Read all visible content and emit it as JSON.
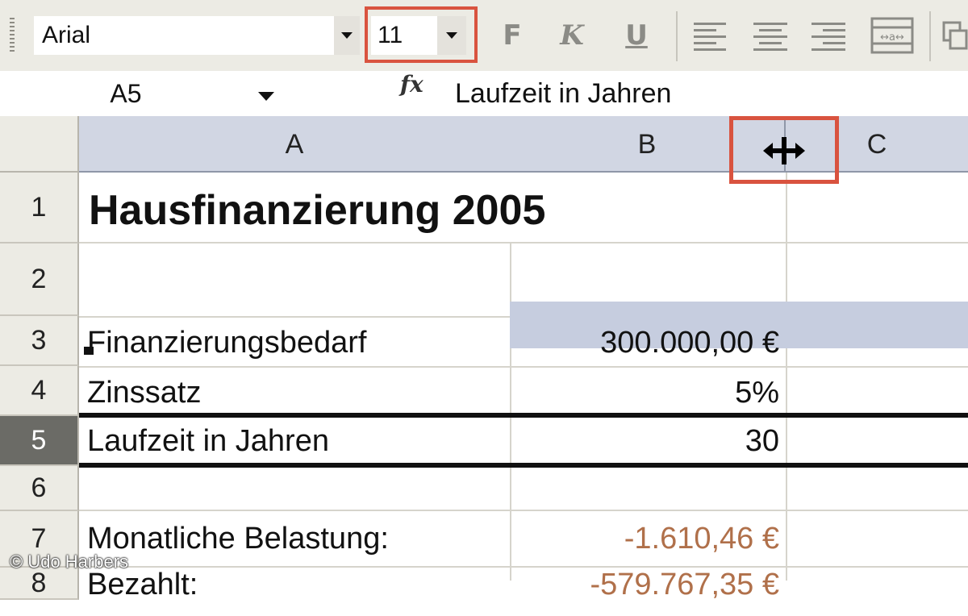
{
  "toolbar": {
    "font_name": "Arial",
    "font_size": "11",
    "bold_label": "F",
    "italic_label": "K",
    "underline_label": "U"
  },
  "formula_bar": {
    "name_box": "A5",
    "fx_label": "fx",
    "content": "Laufzeit in Jahren"
  },
  "columns": [
    "A",
    "B",
    "C"
  ],
  "rows": [
    "1",
    "2",
    "3",
    "4",
    "5",
    "6",
    "7",
    "8"
  ],
  "cells": {
    "A1": "Hausfinanzierung 2005",
    "A3": "Finanzierungsbedarf",
    "B3": "300.000,00 €",
    "A4": "Zinssatz",
    "B4": "5%",
    "A5": "Laufzeit in Jahren",
    "B5": "30",
    "A7": "Monatliche Belastung:",
    "B7": "-1.610,46 €",
    "A8": "Bezahlt:",
    "B8": "-579.767,35 €"
  },
  "watermark": "© Udo Harbers",
  "colors": {
    "highlight_box": "#d9533f",
    "selection": "#c6cddf",
    "negative_value": "#b0704a"
  }
}
